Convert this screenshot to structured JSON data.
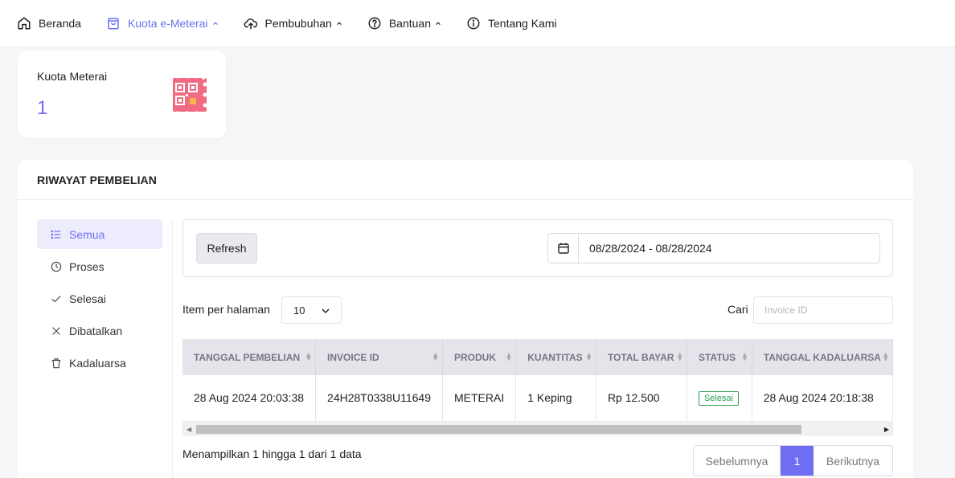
{
  "nav": {
    "items": [
      {
        "label": "Beranda",
        "icon": "home-icon"
      },
      {
        "label": "Kuota e-Meterai",
        "icon": "shopping-bag-icon",
        "active": true
      },
      {
        "label": "Pembubuhan",
        "icon": "cloud-upload-icon"
      },
      {
        "label": "Bantuan",
        "icon": "help-circle-icon"
      },
      {
        "label": "Tentang Kami",
        "icon": "info-circle-icon"
      }
    ]
  },
  "quota": {
    "title": "Kuota Meterai",
    "value": "1"
  },
  "riwayat": {
    "title": "RIWAYAT PEMBELIAN",
    "sidebar": [
      {
        "label": "Semua",
        "icon": "list-icon"
      },
      {
        "label": "Proses",
        "icon": "clock-icon"
      },
      {
        "label": "Selesai",
        "icon": "check-icon"
      },
      {
        "label": "Dibatalkan",
        "icon": "x-icon"
      },
      {
        "label": "Kadaluarsa",
        "icon": "trash-icon"
      }
    ],
    "refresh_label": "Refresh",
    "date_range": "08/28/2024 - 08/28/2024",
    "per_page_label": "Item per halaman",
    "per_page_value": "10",
    "search_label": "Cari",
    "search_placeholder": "Invoice ID",
    "table": {
      "columns": [
        "TANGGAL PEMBELIAN",
        "INVOICE ID",
        "PRODUK",
        "KUANTITAS",
        "TOTAL BAYAR",
        "STATUS",
        "TANGGAL KADALUARSA"
      ],
      "rows": [
        [
          "28 Aug 2024 20:03:38",
          "24H28T0338U11649",
          "METERAI",
          "1 Keping",
          "Rp 12.500",
          "Selesai",
          "28 Aug 2024 20:18:38"
        ]
      ]
    },
    "showing_text": "Menampilkan 1 hingga 1 dari 1 data",
    "pager": {
      "prev": "Sebelumnya",
      "current": "1",
      "next": "Berikutnya"
    }
  },
  "colors": {
    "accent": "#6f6ef3",
    "status_done": "#2e9e52",
    "quota_icon": "#f06a82"
  }
}
